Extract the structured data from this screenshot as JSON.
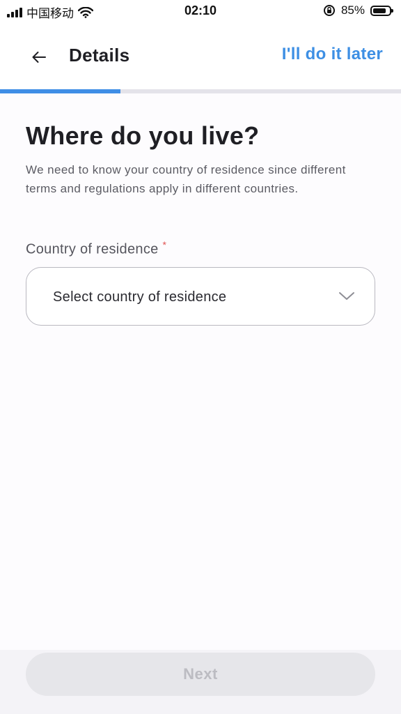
{
  "status_bar": {
    "carrier": "中国移动",
    "time": "02:10",
    "battery_percent": "85%",
    "battery_level": 0.85,
    "icons": [
      "signal-icon",
      "wifi-icon",
      "rotation-lock-icon",
      "battery-icon"
    ]
  },
  "header": {
    "title": "Details",
    "skip_label": "I'll do it later",
    "back_icon": "arrow-left-icon"
  },
  "progress": {
    "fraction": 0.3
  },
  "main": {
    "heading": "Where do you live?",
    "description": "We need to know your country of residence since different terms and regulations apply in different countries."
  },
  "country_field": {
    "label": "Country of residence",
    "required_mark": "*",
    "placeholder": "Select country of residence",
    "chevron_icon": "chevron-down-icon"
  },
  "footer": {
    "next_label": "Next"
  },
  "colors": {
    "accent": "#3d8fe4",
    "required": "#e05252",
    "disabled_text": "#bcbcc2"
  }
}
